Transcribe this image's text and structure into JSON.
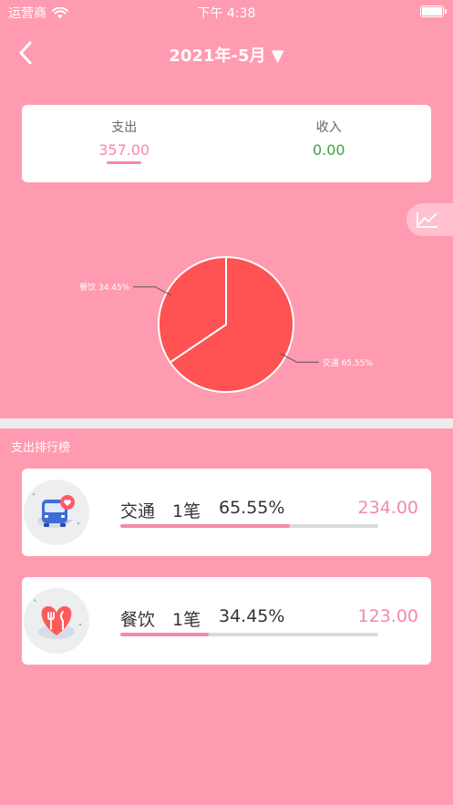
{
  "status_bar": {
    "carrier": "运营商",
    "time": "下午 4:38"
  },
  "nav": {
    "title": "2021年-5月 ▼"
  },
  "summary": {
    "expense_label": "支出",
    "expense_value": "357.00",
    "income_label": "收入",
    "income_value": "0.00"
  },
  "chart_data": {
    "type": "pie",
    "slices": [
      {
        "label": "交通 65.55%",
        "value": 65.55,
        "color": "#ff5252"
      },
      {
        "label": "餐饮 34.45%",
        "value": 34.45,
        "color": "#ff5252"
      }
    ]
  },
  "section_title": "支出排行榜",
  "ranking": [
    {
      "name": "交通",
      "count": "1笔",
      "percent": "65.55%",
      "amount": "234.00",
      "ratio": 0.6555,
      "icon": "bus-icon"
    },
    {
      "name": "餐饮",
      "count": "1笔",
      "percent": "34.45%",
      "amount": "123.00",
      "ratio": 0.3445,
      "icon": "dining-icon"
    }
  ],
  "colors": {
    "background": "#ff9bb0",
    "accent": "#f58aa6",
    "income": "#3fa33f",
    "pie_slice": "#ff5252"
  }
}
